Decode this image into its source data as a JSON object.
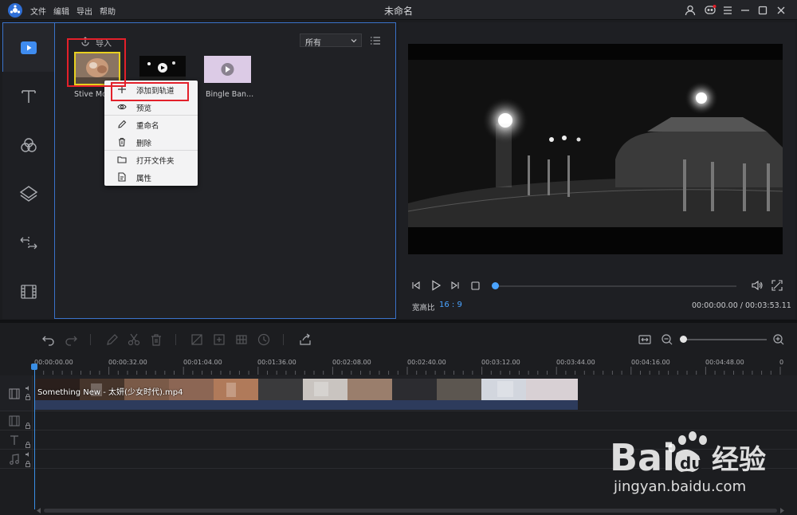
{
  "titlebar": {
    "menu": [
      "文件",
      "编辑",
      "导出",
      "帮助"
    ],
    "title": "未命名"
  },
  "sidebar": {
    "items": [
      {
        "icon": "media-icon",
        "active": true
      },
      {
        "icon": "text-icon"
      },
      {
        "icon": "filter-icon"
      },
      {
        "icon": "overlay-icon"
      },
      {
        "icon": "transition-icon"
      },
      {
        "icon": "film-icon"
      }
    ]
  },
  "library": {
    "import_label": "导入",
    "filter_value": "所有",
    "items": [
      {
        "name": "Stive Mo"
      },
      {
        "name": ""
      },
      {
        "name": "Bingle Ban..."
      }
    ]
  },
  "context_menu": {
    "items": [
      {
        "label": "添加到轨道",
        "icon": "plus-icon"
      },
      {
        "label": "预览",
        "icon": "eye-icon"
      },
      {
        "label": "重命名",
        "icon": "pencil-icon"
      },
      {
        "label": "删除",
        "icon": "trash-icon"
      },
      {
        "label": "打开文件夹",
        "icon": "folder-icon"
      },
      {
        "label": "属性",
        "icon": "properties-icon"
      }
    ]
  },
  "preview": {
    "ratio_label": "宽高比",
    "ratio_value": "16 : 9",
    "timecode": "00:00:00.00 / 00:03:53.11",
    "progress": 0
  },
  "timeline": {
    "ticks": [
      "00:00:00.00",
      "00:00:32.00",
      "00:01:04.00",
      "00:01:36.00",
      "00:02:08.00",
      "00:02:40.00",
      "00:03:12.00",
      "00:03:44.00",
      "00:04:16.00",
      "00:04:48.00",
      "0"
    ],
    "clip_name": "Something New - 太妍(少女时代).mp4"
  },
  "watermark": {
    "brand": "Bai",
    "brand2": "du",
    "brand_cn": "经验",
    "url": "jingyan.baidu.com"
  },
  "colors": {
    "accent": "#3a72c9",
    "highlight": "#e3202a",
    "link": "#4aa3ff"
  }
}
